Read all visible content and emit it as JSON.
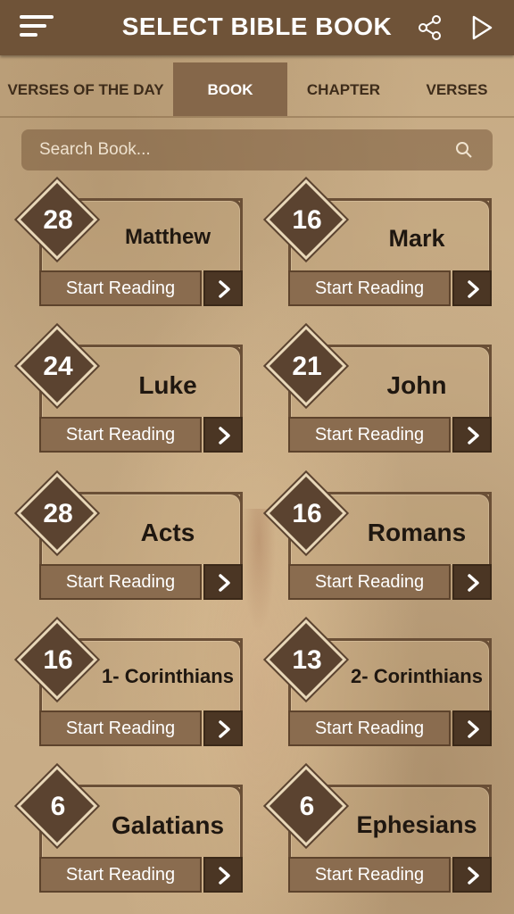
{
  "header": {
    "title": "SELECT BIBLE BOOK",
    "menu_icon": "hamburger-menu-icon",
    "share_icon": "share-icon",
    "play_icon": "play-icon"
  },
  "tabs": [
    {
      "label": "VERSES OF THE DAY",
      "active": false
    },
    {
      "label": "BOOK",
      "active": true
    },
    {
      "label": "CHAPTER",
      "active": false
    },
    {
      "label": "VERSES",
      "active": false
    }
  ],
  "search": {
    "placeholder": "Search Book...",
    "icon": "search-icon"
  },
  "books": [
    {
      "name": "Matthew",
      "chapters": "28",
      "button": "Start Reading"
    },
    {
      "name": "Mark",
      "chapters": "16",
      "button": "Start Reading"
    },
    {
      "name": "Luke",
      "chapters": "24",
      "button": "Start Reading"
    },
    {
      "name": "John",
      "chapters": "21",
      "button": "Start Reading"
    },
    {
      "name": "Acts",
      "chapters": "28",
      "button": "Start Reading"
    },
    {
      "name": "Romans",
      "chapters": "16",
      "button": "Start Reading"
    },
    {
      "name": "1- Corinthians",
      "chapters": "16",
      "button": "Start Reading"
    },
    {
      "name": "2- Corinthians",
      "chapters": "13",
      "button": "Start Reading"
    },
    {
      "name": "Galatians",
      "chapters": "6",
      "button": "Start Reading"
    },
    {
      "name": "Ephesians",
      "chapters": "6",
      "button": "Start Reading"
    }
  ],
  "colors": {
    "header_bg": "#6f5338",
    "active_tab_bg": "#85674a",
    "badge_bg": "#5b4330",
    "button_bg": "#8a6c4f",
    "arrow_bg": "#4b3624"
  }
}
